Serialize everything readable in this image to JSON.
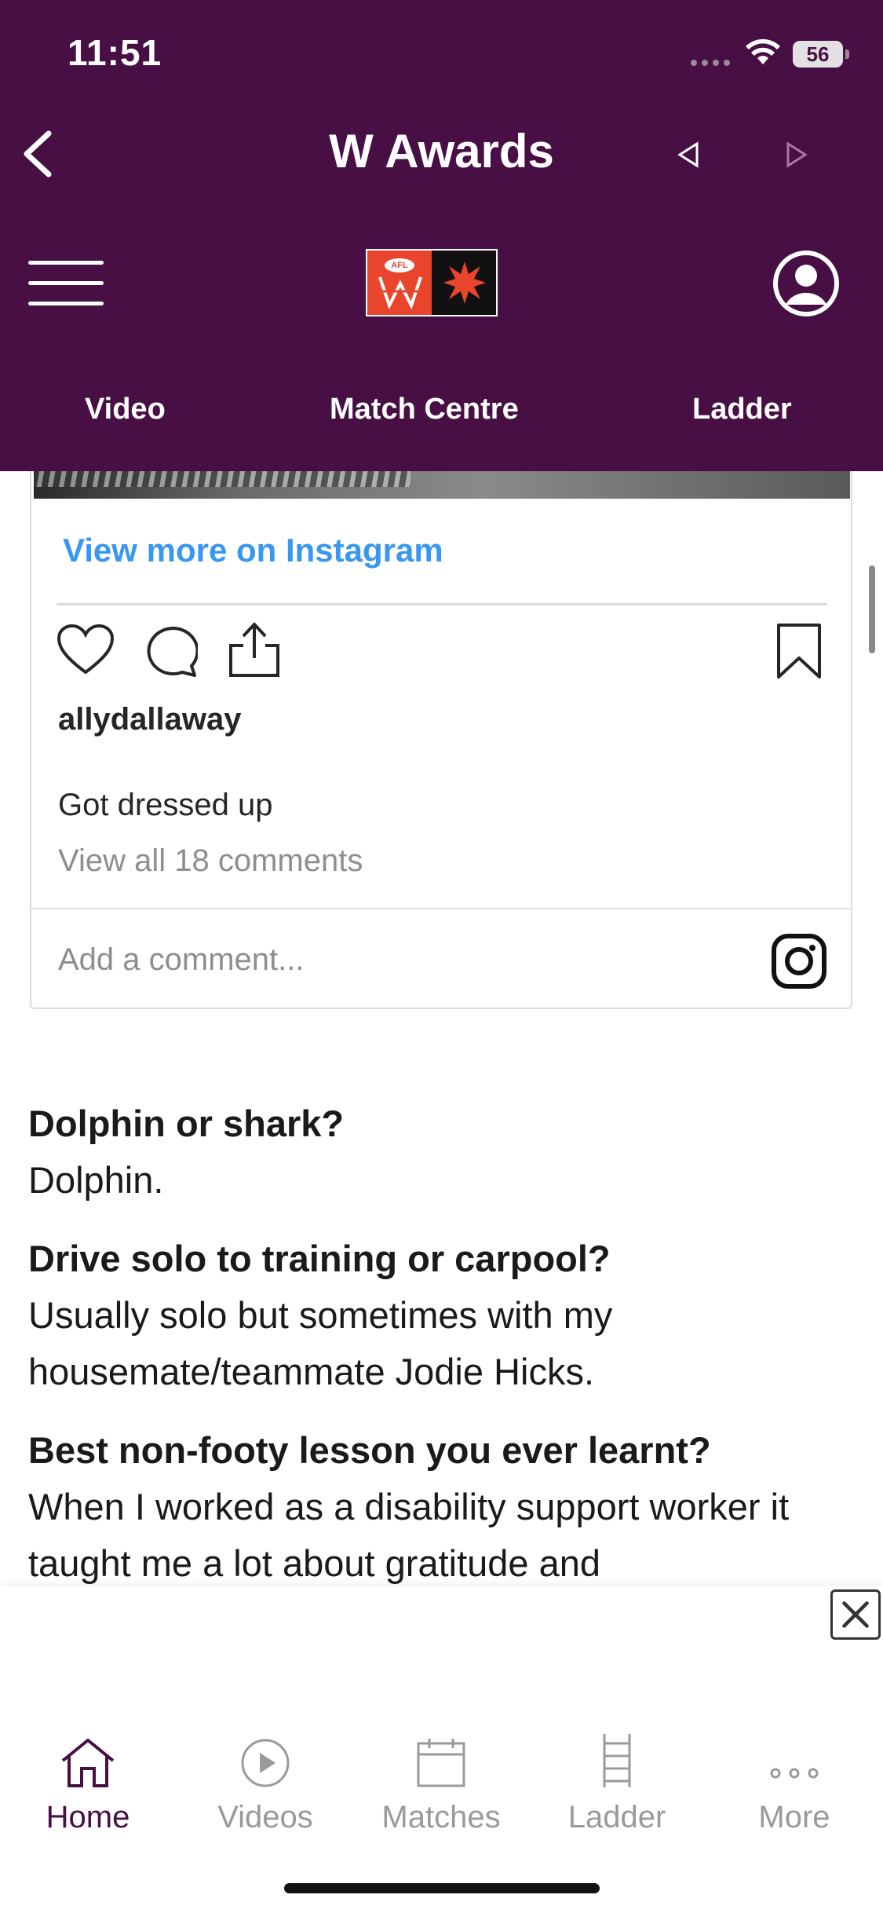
{
  "status_bar": {
    "time": "11:51",
    "battery": "56"
  },
  "header": {
    "title": "W Awards",
    "logo_text": "AFL",
    "tabs": [
      "Video",
      "Match Centre",
      "Ladder"
    ]
  },
  "instagram": {
    "view_more": "View more on Instagram",
    "username": "allydallaway",
    "caption": "Got dressed up",
    "view_comments": "View all 18 comments",
    "add_comment_placeholder": "Add a comment..."
  },
  "article": {
    "qa": [
      {
        "q": "Dolphin or shark?",
        "a": "Dolphin."
      },
      {
        "q": "Drive solo to training or carpool?",
        "a": "Usually solo but sometimes with my housemate/teammate Jodie Hicks."
      },
      {
        "q": "Best non-footy lesson you ever learnt?",
        "a": "When I worked as a disability support worker it taught me a lot about gratitude and"
      }
    ]
  },
  "tabbar": {
    "items": [
      {
        "label": "Home",
        "icon": "home-icon"
      },
      {
        "label": "Videos",
        "icon": "play-circle-icon"
      },
      {
        "label": "Matches",
        "icon": "calendar-icon"
      },
      {
        "label": "Ladder",
        "icon": "ladder-icon"
      },
      {
        "label": "More",
        "icon": "more-dots-icon"
      }
    ]
  },
  "colors": {
    "brand_purple": "#480f44",
    "instagram_blue": "#3897f0",
    "afl_orange": "#e8452c"
  }
}
